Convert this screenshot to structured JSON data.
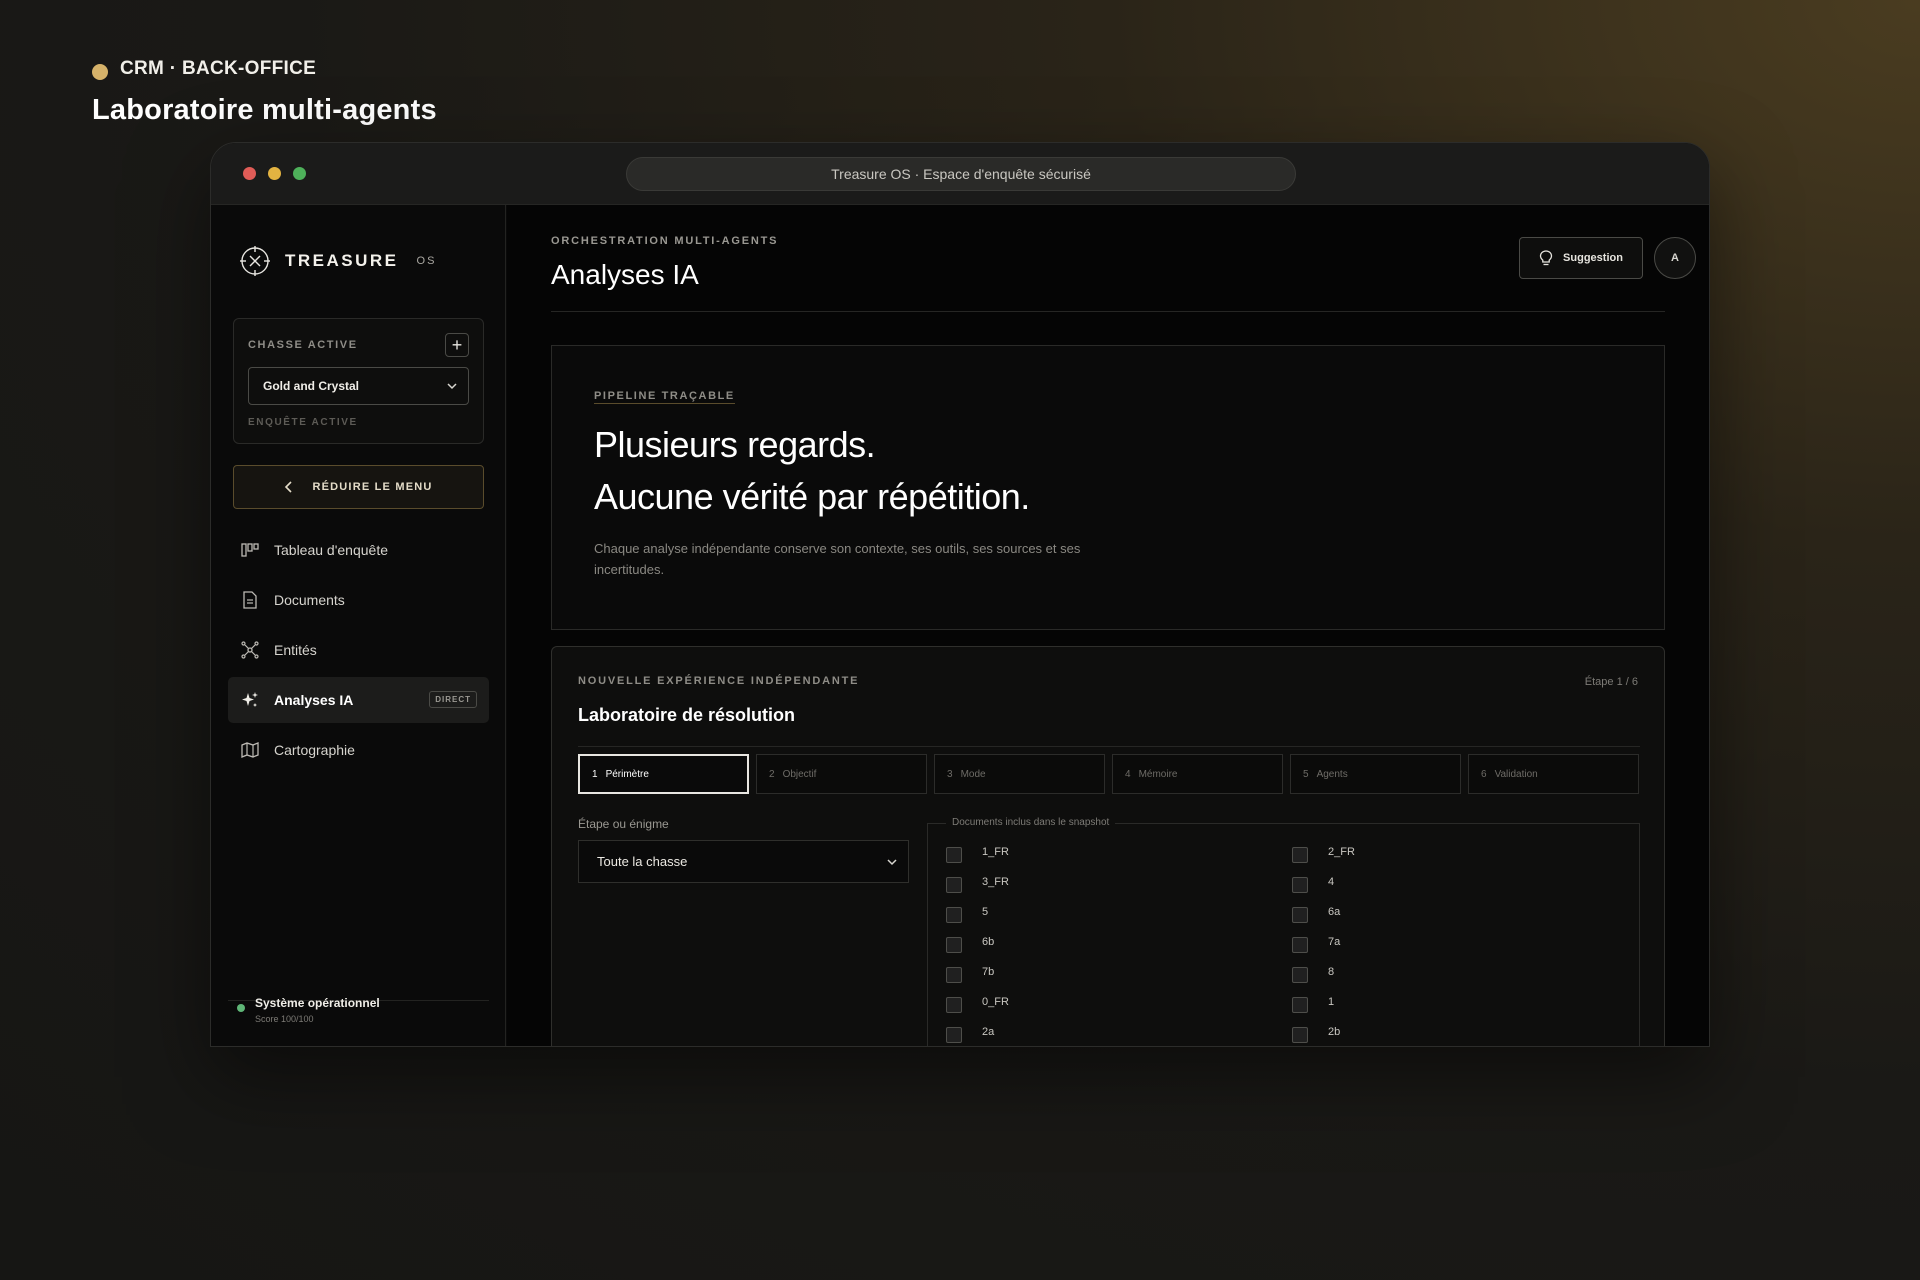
{
  "page": {
    "eyebrow": "CRM · BACK-OFFICE",
    "title": "Laboratoire multi-agents"
  },
  "window": {
    "url": "Treasure OS · Espace d'enquête sécurisé"
  },
  "sidebar": {
    "brand": "TREASURE",
    "brand_sub": "OS",
    "hunt": {
      "label": "CHASSE ACTIVE",
      "add": "+",
      "selected": "Gold and Crystal",
      "footer": "ENQUÊTE ACTIVE"
    },
    "collapse_label": "RÉDUIRE LE MENU",
    "items": [
      {
        "label": "Tableau d'enquête",
        "icon": "board-icon"
      },
      {
        "label": "Documents",
        "icon": "document-icon"
      },
      {
        "label": "Entités",
        "icon": "network-icon"
      },
      {
        "label": "Analyses IA",
        "icon": "sparkles-icon",
        "badge": "DIRECT",
        "active": true
      },
      {
        "label": "Cartographie",
        "icon": "map-icon"
      }
    ],
    "status": {
      "title": "Système opérationnel",
      "score": "Score 100/100"
    }
  },
  "header": {
    "eyebrow": "ORCHESTRATION MULTI-AGENTS",
    "title": "Analyses IA",
    "suggestion_label": "Suggestion",
    "avatar_initial": "A"
  },
  "hero": {
    "eyebrow": "PIPELINE TRAÇABLE",
    "line1": "Plusieurs regards.",
    "line2": "Aucune vérité par répétition.",
    "description": "Chaque analyse indépendante conserve son contexte, ses outils, ses sources et ses incertitudes."
  },
  "lab": {
    "eyebrow": "NOUVELLE EXPÉRIENCE INDÉPENDANTE",
    "step": "Étape 1 / 6",
    "title": "Laboratoire de résolution",
    "tabs": [
      {
        "num": "1",
        "label": "Périmètre",
        "active": true
      },
      {
        "num": "2",
        "label": "Objectif"
      },
      {
        "num": "3",
        "label": "Mode"
      },
      {
        "num": "4",
        "label": "Mémoire"
      },
      {
        "num": "5",
        "label": "Agents"
      },
      {
        "num": "6",
        "label": "Validation"
      }
    ],
    "field_label": "Étape ou énigme",
    "field_value": "Toute la chasse",
    "docs_legend": "Documents inclus dans le snapshot",
    "docs": [
      "1_FR",
      "2_FR",
      "3_FR",
      "4",
      "5",
      "6a",
      "6b",
      "7a",
      "7b",
      "8",
      "0_FR",
      "1",
      "2a",
      "2b"
    ]
  },
  "colors": {
    "accent": "#d6b26a",
    "status_ok": "#5fb677",
    "window_bg": "#0a0a0a"
  }
}
